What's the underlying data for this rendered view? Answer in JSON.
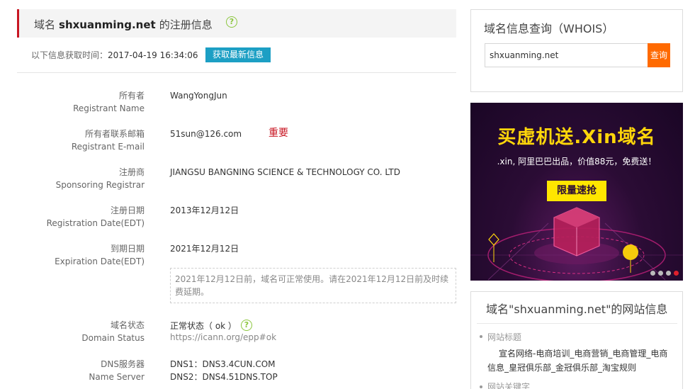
{
  "header": {
    "prefix": "域名",
    "domain": "shxuanming.net",
    "suffix": "的注册信息",
    "help_glyph": "?",
    "accent_color": "#c81623"
  },
  "fetch": {
    "label": "以下信息获取时间：",
    "time": "2017-04-19 16:34:06",
    "button": "获取最新信息",
    "button_color": "#1c9fc4"
  },
  "rows": [
    {
      "label_cn": "所有者",
      "label_en": "Registrant Name",
      "value": "WangYongJun"
    },
    {
      "label_cn": "所有者联系邮箱",
      "label_en": "Registrant E-mail",
      "value": "51sun@126.com"
    },
    {
      "label_cn": "注册商",
      "label_en": "Sponsoring Registrar",
      "value": "JIANGSU BANGNING SCIENCE & TECHNOLOGY CO. LTD"
    },
    {
      "label_cn": "注册日期",
      "label_en": "Registration Date(EDT)",
      "value": "2013年12月12日"
    },
    {
      "label_cn": "到期日期",
      "label_en": "Expiration Date(EDT)",
      "value": "2021年12月12日"
    }
  ],
  "important_note": "重要",
  "expiry_notice": "2021年12月12日前，域名可正常使用。请在2021年12月12日前及时续费延期。",
  "status": {
    "label_cn": "域名状态",
    "label_en": "Domain Status",
    "value": "正常状态（ ok ）",
    "link": "https://icann.org/epp#ok"
  },
  "dns": {
    "label_cn": "DNS服务器",
    "label_en": "Name Server",
    "servers": [
      "DNS1：DNS3.4CUN.COM",
      "DNS2：DNS4.51DNS.TOP"
    ]
  },
  "whois": {
    "title": "域名信息查询（WHOIS）",
    "input_value": "shxuanming.net",
    "button": "查询",
    "button_color": "#ff6a00"
  },
  "ad": {
    "title": "买虚机送.Xin域名",
    "subtitle": ".xin, 阿里巴巴出品，价值88元，免费送！",
    "button": "限量速抢",
    "slide_count": 4,
    "active_slide": 4
  },
  "site_info": {
    "title": "域名\"shxuanming.net\"的网站信息",
    "site_title_label": "网站标题",
    "site_title_value": "宣名网络-电商培训_电商营销_电商管理_电商信息_皇冠俱乐部_金冠俱乐部_淘宝规则",
    "keywords_label": "网站关键字"
  }
}
